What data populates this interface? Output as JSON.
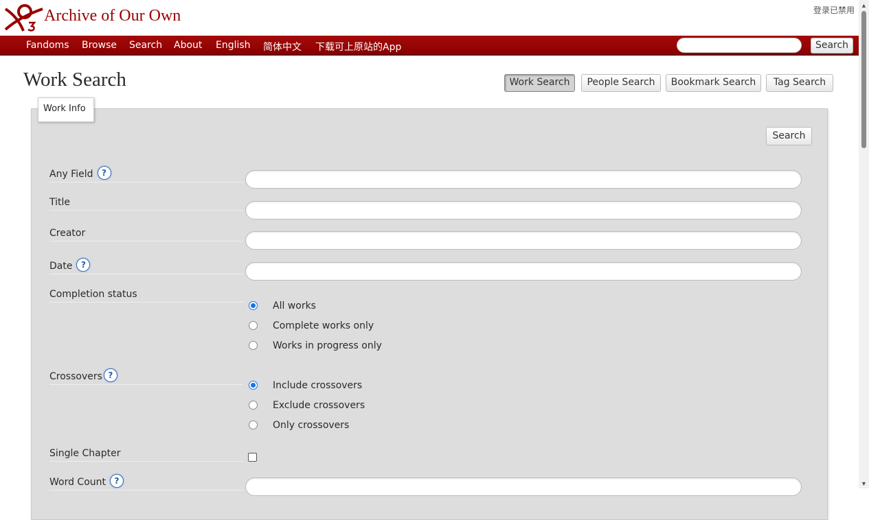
{
  "header": {
    "site_title": "Archive of Our Own",
    "login_status": "登录已禁用"
  },
  "nav": {
    "items": [
      "Fandoms",
      "Browse",
      "Search",
      "About",
      "English",
      "简体中文",
      "下载可上原站的App"
    ],
    "search_button": "Search",
    "search_placeholder": ""
  },
  "page": {
    "title": "Work Search",
    "tabs": [
      {
        "label": "Work Search",
        "active": true
      },
      {
        "label": "People Search",
        "active": false
      },
      {
        "label": "Bookmark Search",
        "active": false
      },
      {
        "label": "Tag Search",
        "active": false
      }
    ]
  },
  "form": {
    "legend": "Work Info",
    "search_button": "Search",
    "help_icon_glyph": "?",
    "fields": {
      "any_field": {
        "label": "Any Field",
        "value": ""
      },
      "title": {
        "label": "Title",
        "value": ""
      },
      "creator": {
        "label": "Creator",
        "value": ""
      },
      "date": {
        "label": "Date",
        "value": ""
      },
      "word_count": {
        "label": "Word Count",
        "value": ""
      }
    },
    "completion_status": {
      "label": "Completion status",
      "options": [
        "All works",
        "Complete works only",
        "Works in progress only"
      ],
      "selected": "All works"
    },
    "crossovers": {
      "label": "Crossovers",
      "options": [
        "Include crossovers",
        "Exclude crossovers",
        "Only crossovers"
      ],
      "selected": "Include crossovers"
    },
    "single_chapter": {
      "label": "Single Chapter",
      "checked": false
    }
  },
  "colors": {
    "brand": "#990000",
    "navbar": "#8b0000",
    "panel": "#dddddd",
    "radio_checked": "#1a73e8"
  }
}
